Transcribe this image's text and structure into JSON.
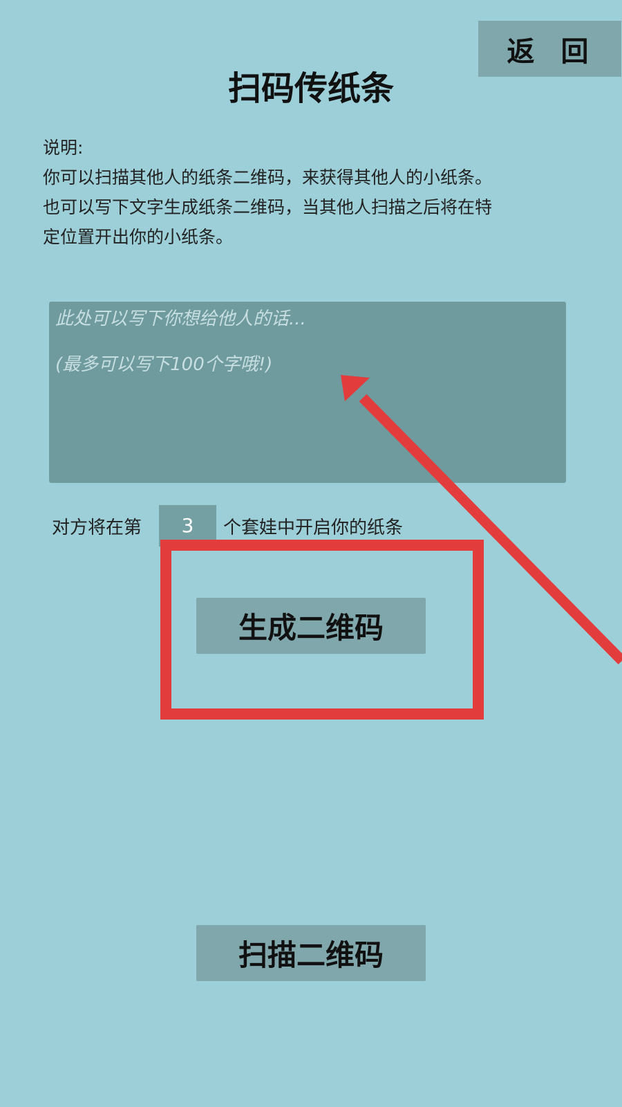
{
  "header": {
    "back_label": "返 回",
    "title": "扫码传纸条"
  },
  "instructions": {
    "heading": "说明:",
    "line1": "你可以扫描其他人的纸条二维码，来获得其他人的小纸条。",
    "line2": "也可以写下文字生成纸条二维码，当其他人扫描之后将在特",
    "line3": "定位置开出你的小纸条。"
  },
  "message_input": {
    "placeholder_line1": "此处可以写下你想给他人的话...",
    "placeholder_line2": "(最多可以写下100个字哦!)"
  },
  "layer": {
    "label_before": "对方将在第",
    "value": "3",
    "label_after": "个套娃中开启你的纸条"
  },
  "buttons": {
    "generate_label": "生成二维码",
    "scan_label": "扫描二维码"
  },
  "colors": {
    "background": "#9ccfd8",
    "button": "#80a7ab",
    "input": "#6f9a9e",
    "annotation": "#e33c3c"
  }
}
